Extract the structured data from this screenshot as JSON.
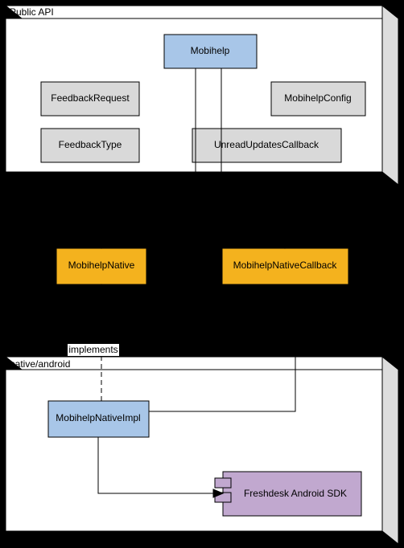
{
  "packages": {
    "publicApi": {
      "title": "Public API"
    },
    "nativeAndroid": {
      "title": "native/android"
    }
  },
  "boxes": {
    "mobihelp": "Mobihelp",
    "feedbackRequest": "FeedbackRequest",
    "mobihelpConfig": "MobihelpConfig",
    "feedbackType": "FeedbackType",
    "unreadUpdatesCallback": "UnreadUpdatesCallback",
    "mobihelpNative": "MobihelpNative",
    "mobihelpNativeCallback": "MobihelpNativeCallback",
    "mobihelpNativeImpl": "MobihelpNativeImpl",
    "freshdeskSdk": "Freshdesk Android SDK"
  },
  "edges": {
    "implements": "implements"
  }
}
